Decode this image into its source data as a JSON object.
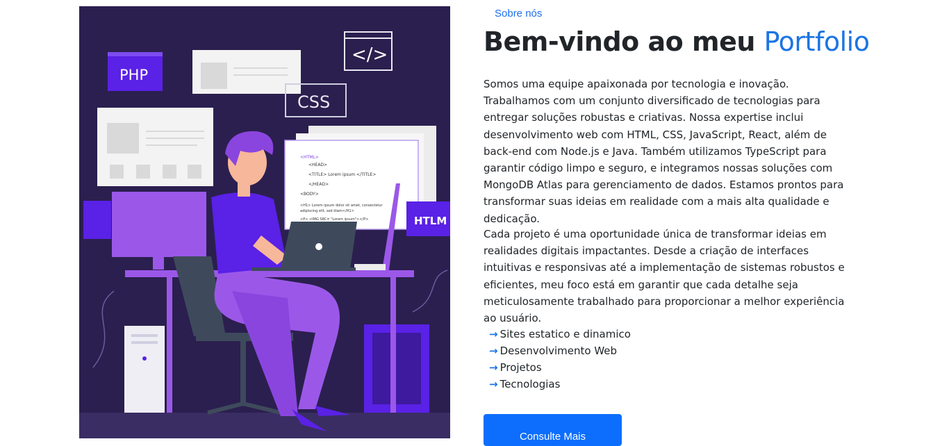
{
  "illustration": {
    "labels": {
      "php": "PHP",
      "css": "CSS",
      "htlm": "HTLM",
      "code_glyph": "</>"
    },
    "code_lines": [
      "<HTML>",
      "<HEAD>",
      "<TITLE> Lorem ipsum </TITLE>",
      "</HEAD>",
      "<BODY>",
      "<H1> Lorem ipsum dolor sit amet, consectetur",
      "adipiscing elit, sed diam</H1>",
      "<P> <IMG SRC= \"Lorem ipsum\"></P>"
    ]
  },
  "about": {
    "eyebrow": "Sobre nós",
    "title_prefix": "Bem-vindo ao meu ",
    "title_accent": "Portfolio",
    "paragraph_1": "Somos uma equipe apaixonada por tecnologia e inovação. Trabalhamos com um conjunto diversificado de tecnologias para entregar soluções robustas e criativas. Nossa expertise inclui desenvolvimento web com HTML, CSS, JavaScript, React, além de back-end com Node.js e Java. Também utilizamos TypeScript para garantir código limpo e seguro, e integramos nossas soluções com MongoDB Atlas para gerenciamento de dados. Estamos prontos para transformar suas ideias em realidade com a mais alta qualidade e dedicação.",
    "paragraph_2": "Cada projeto é uma oportunidade única de transformar ideias em realidades digitais impactantes. Desde a criação de interfaces intuitivas e responsivas até a implementação de sistemas robustos e eficientes, meu foco está em garantir que cada detalhe seja meticulosamente trabalhado para proporcionar a melhor experiência ao usuário.",
    "features": [
      "Sites estatico e dinamico",
      "Desenvolvimento Web",
      "Projetos",
      "Tecnologias"
    ],
    "feature_icon": "arrow-right-icon",
    "cta_label": "Consulte Mais"
  },
  "colors": {
    "accent": "#1b74e4",
    "button": "#0d6efd",
    "illustration_bg": "#2b1f4f",
    "purple": "#7b3fe4"
  }
}
